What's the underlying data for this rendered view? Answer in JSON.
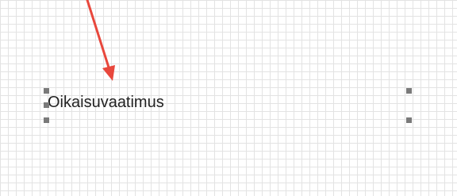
{
  "canvas": {
    "text_box": {
      "text": "Oikaisuvaatimus"
    }
  },
  "colors": {
    "annotation_arrow": "#e8473c",
    "handle": "#7a7a7a",
    "grid": "#e3e3e3"
  }
}
